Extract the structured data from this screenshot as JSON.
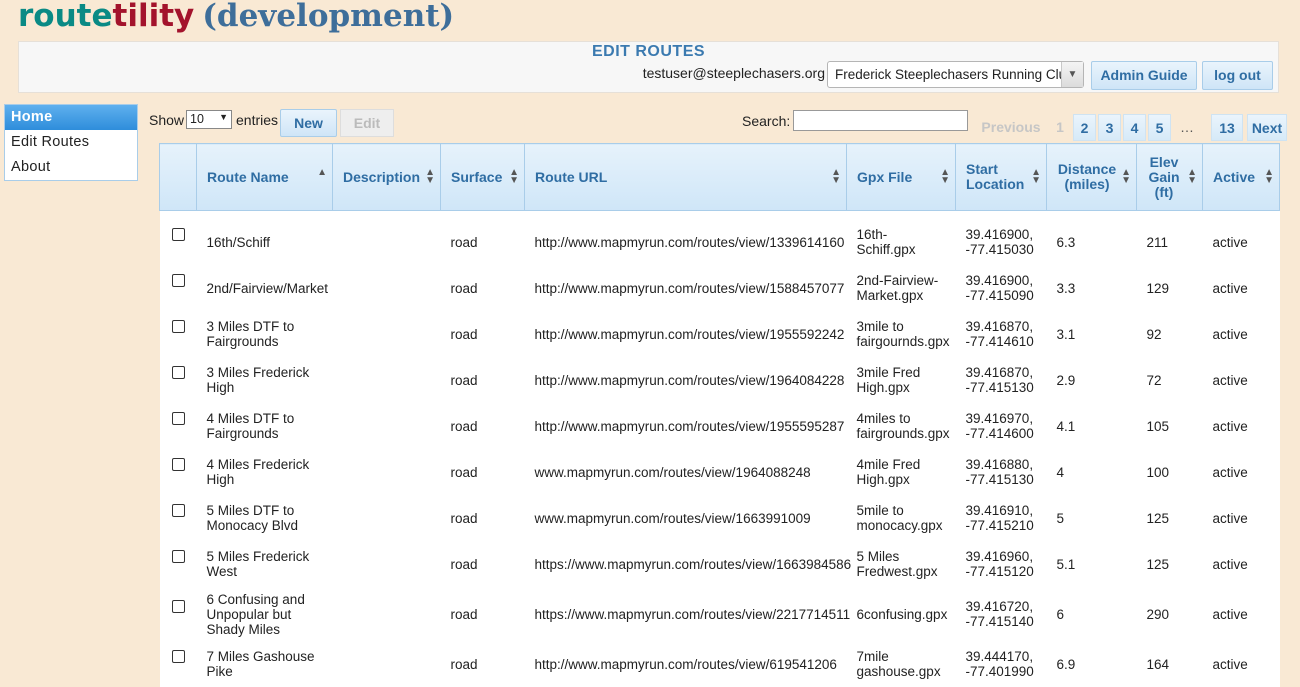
{
  "brand": {
    "part1": "route",
    "part2": "tility",
    "env": "(development)"
  },
  "header": {
    "title": "EDIT ROUTES",
    "user_email": "testuser@steeplechasers.org",
    "club": "Frederick Steeplechasers Running Club",
    "admin_guide": "Admin Guide",
    "logout": "log out"
  },
  "sidebar": {
    "items": [
      {
        "label": "Home"
      },
      {
        "label": "Edit Routes"
      },
      {
        "label": "About"
      }
    ]
  },
  "controls": {
    "show": "Show",
    "entries_value": "10",
    "entries": "entries",
    "new": "New",
    "edit": "Edit",
    "search_label": "Search:",
    "search_value": ""
  },
  "pagination": {
    "previous": "Previous",
    "p1": "1",
    "p2": "2",
    "p3": "3",
    "p4": "4",
    "p5": "5",
    "ellipsis": "…",
    "last": "13",
    "next": "Next"
  },
  "table": {
    "columns": [
      "",
      "Route Name",
      "Description",
      "Surface",
      "Route URL",
      "Gpx File",
      "Start Location",
      "Distance (miles)",
      "Elev Gain (ft)",
      "Active"
    ],
    "rows": [
      [
        "16th/Schiff",
        "",
        "road",
        "http://www.mapmyrun.com/routes/view/1339614160",
        "16th-Schiff.gpx",
        "39.416900,\n-77.415030",
        "6.3",
        "211",
        "active"
      ],
      [
        "2nd/Fairview/Market",
        "",
        "road",
        "http://www.mapmyrun.com/routes/view/1588457077",
        "2nd-Fairview-\nMarket.gpx",
        "39.416900,\n-77.415090",
        "3.3",
        "129",
        "active"
      ],
      [
        "3 Miles DTF to\nFairgrounds",
        "",
        "road",
        "http://www.mapmyrun.com/routes/view/1955592242",
        "3mile to\nfairgournds.gpx",
        "39.416870,\n-77.414610",
        "3.1",
        "92",
        "active"
      ],
      [
        "3 Miles Frederick\nHigh",
        "",
        "road",
        "http://www.mapmyrun.com/routes/view/1964084228",
        "3mile Fred\nHigh.gpx",
        "39.416870,\n-77.415130",
        "2.9",
        "72",
        "active"
      ],
      [
        "4 Miles DTF to\nFairgrounds",
        "",
        "road",
        "http://www.mapmyrun.com/routes/view/1955595287",
        "4miles to\nfairgrounds.gpx",
        "39.416970,\n-77.414600",
        "4.1",
        "105",
        "active"
      ],
      [
        "4 Miles Frederick\nHigh",
        "",
        "road",
        "www.mapmyrun.com/routes/view/1964088248",
        "4mile Fred\nHigh.gpx",
        "39.416880,\n-77.415130",
        "4",
        "100",
        "active"
      ],
      [
        "5 Miles DTF to\nMonocacy Blvd",
        "",
        "road",
        "www.mapmyrun.com/routes/view/1663991009",
        "5mile to\nmonocacy.gpx",
        "39.416910,\n-77.415210",
        "5",
        "125",
        "active"
      ],
      [
        "5 Miles Frederick\nWest",
        "",
        "road",
        "https://www.mapmyrun.com/routes/view/1663984586",
        "5 Miles\nFredwest.gpx",
        "39.416960,\n-77.415120",
        "5.1",
        "125",
        "active"
      ],
      [
        "6 Confusing and\nUnpopular but\nShady Miles",
        "",
        "road",
        "https://www.mapmyrun.com/routes/view/2217714511",
        "6confusing.gpx",
        "39.416720,\n-77.415140",
        "6",
        "290",
        "active"
      ],
      [
        "7 Miles Gashouse\nPike",
        "",
        "road",
        "http://www.mapmyrun.com/routes/view/619541206",
        "7mile\ngashouse.gpx",
        "39.444170,\n-77.401990",
        "6.9",
        "164",
        "active"
      ]
    ]
  }
}
